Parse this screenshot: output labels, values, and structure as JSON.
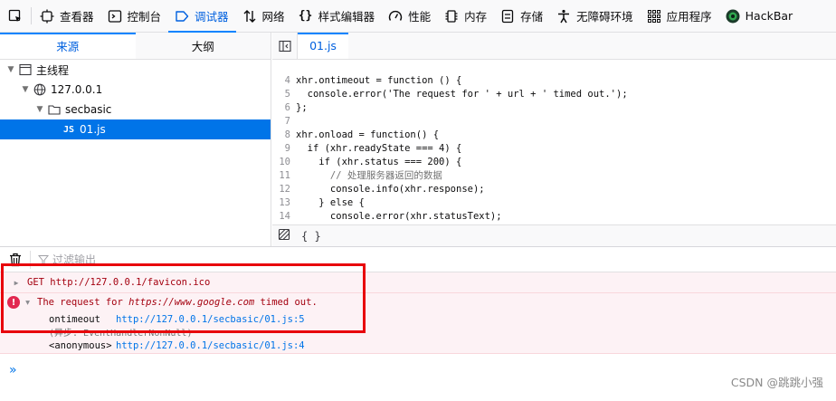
{
  "toolbar": {
    "tools": [
      {
        "label": "查看器"
      },
      {
        "label": "控制台"
      },
      {
        "label": "调试器"
      },
      {
        "label": "网络"
      },
      {
        "label": "样式编辑器"
      },
      {
        "label": "性能"
      },
      {
        "label": "内存"
      },
      {
        "label": "存储"
      },
      {
        "label": "无障碍环境"
      },
      {
        "label": "应用程序"
      },
      {
        "label": "HackBar"
      }
    ]
  },
  "sources": {
    "tabs": [
      {
        "label": "来源"
      },
      {
        "label": "大纲"
      }
    ],
    "tree": [
      {
        "label": "主线程"
      },
      {
        "label": "127.0.0.1"
      },
      {
        "label": "secbasic"
      },
      {
        "label": "01.js",
        "badge": "JS"
      }
    ]
  },
  "editor": {
    "tab_label": "01.js",
    "pretty_print": "{ }",
    "lines": [
      {
        "n": "4",
        "text": "xhr.ontimeout = function () {"
      },
      {
        "n": "5",
        "text": "  console.error('The request for ' + url + ' timed out.');"
      },
      {
        "n": "6",
        "text": "};"
      },
      {
        "n": "7",
        "text": ""
      },
      {
        "n": "8",
        "text": "xhr.onload = function() {"
      },
      {
        "n": "9",
        "text": "  if (xhr.readyState === 4) {"
      },
      {
        "n": "10",
        "text": "    if (xhr.status === 200) {"
      },
      {
        "n": "11",
        "text": "      // 处理服务器返回的数据"
      },
      {
        "n": "12",
        "text": "      console.info(xhr.response);"
      },
      {
        "n": "13",
        "text": "    } else {"
      },
      {
        "n": "14",
        "text": "      console.error(xhr.statusText);"
      }
    ]
  },
  "console": {
    "filter_placeholder": "过滤输出",
    "messages": {
      "get": "GET http://127.0.0.1/favicon.ico",
      "error_prefix": "The request for ",
      "error_url": "https://www.google.com",
      "error_suffix": " timed out.",
      "frame1_fn": "ontimeout",
      "frame1_loc": "http://127.0.0.1/secbasic/01.js:5",
      "async_label": "(异步: EventHandlerNonNull)",
      "frame2_fn": "<anonymous>",
      "frame2_loc": "http://127.0.0.1/secbasic/01.js:4"
    },
    "prompt": "»"
  },
  "watermark": "CSDN @跳跳小强",
  "colors": {
    "accent": "#0a84ff",
    "error": "#a4000f",
    "highlight_box": "#e8000b"
  }
}
